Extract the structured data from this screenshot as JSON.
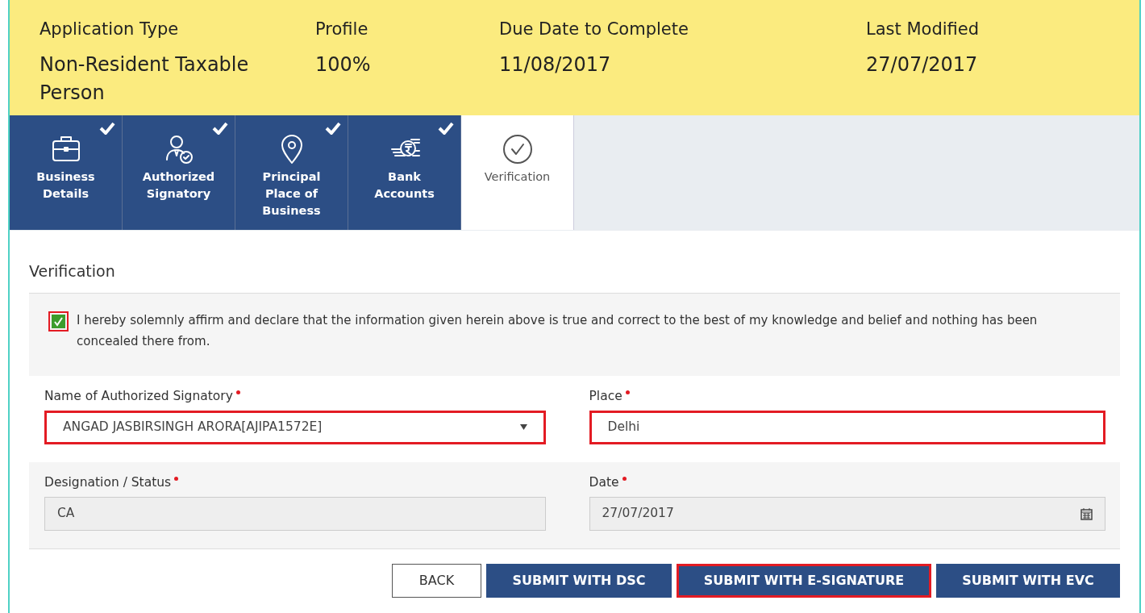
{
  "summary": [
    {
      "label": "Application Type",
      "value": "Non-Resident Taxable Person"
    },
    {
      "label": "Profile",
      "value": "100%"
    },
    {
      "label": "Due Date to Complete",
      "value": "11/08/2017"
    },
    {
      "label": "Last Modified",
      "value": "27/07/2017"
    }
  ],
  "tabs": [
    {
      "kind": "briefcase",
      "label": "Business Details",
      "selected": false,
      "completed": true
    },
    {
      "kind": "signatory",
      "label": "Authorized Signatory",
      "selected": false,
      "completed": true
    },
    {
      "kind": "pin",
      "label": "Principal Place of Business",
      "selected": false,
      "completed": true
    },
    {
      "kind": "bank",
      "label": "Bank Accounts",
      "selected": false,
      "completed": true
    },
    {
      "kind": "verify",
      "label": "Verification",
      "selected": true,
      "completed": false
    }
  ],
  "section_title": "Verification",
  "declaration": {
    "text": "I hereby solemnly affirm and declare that the information given herein above is true and correct to the best of my knowledge and belief and nothing has been concealed there from.",
    "checked": true,
    "highlighted": true
  },
  "fields": [
    {
      "kind": "select",
      "label": "Name of Authorized Signatory",
      "value": "ANGAD JASBIRSINGH ARORA[AJIPA1572E]",
      "highlighted": true,
      "disabled": false
    },
    {
      "kind": "text",
      "label": "Place",
      "value": "Delhi",
      "highlighted": true,
      "disabled": false
    },
    {
      "kind": "text",
      "label": "Designation / Status",
      "value": "CA",
      "highlighted": false,
      "disabled": true
    },
    {
      "kind": "date",
      "label": "Date",
      "value": "27/07/2017",
      "highlighted": false,
      "disabled": true
    }
  ],
  "buttons": [
    {
      "kind": "outline",
      "label": "BACK",
      "highlighted": false
    },
    {
      "kind": "primary",
      "label": "SUBMIT WITH DSC",
      "highlighted": false
    },
    {
      "kind": "primary",
      "label": "SUBMIT WITH E-SIGNATURE",
      "highlighted": true
    },
    {
      "kind": "primary",
      "label": "SUBMIT WITH EVC",
      "highlighted": false
    }
  ]
}
